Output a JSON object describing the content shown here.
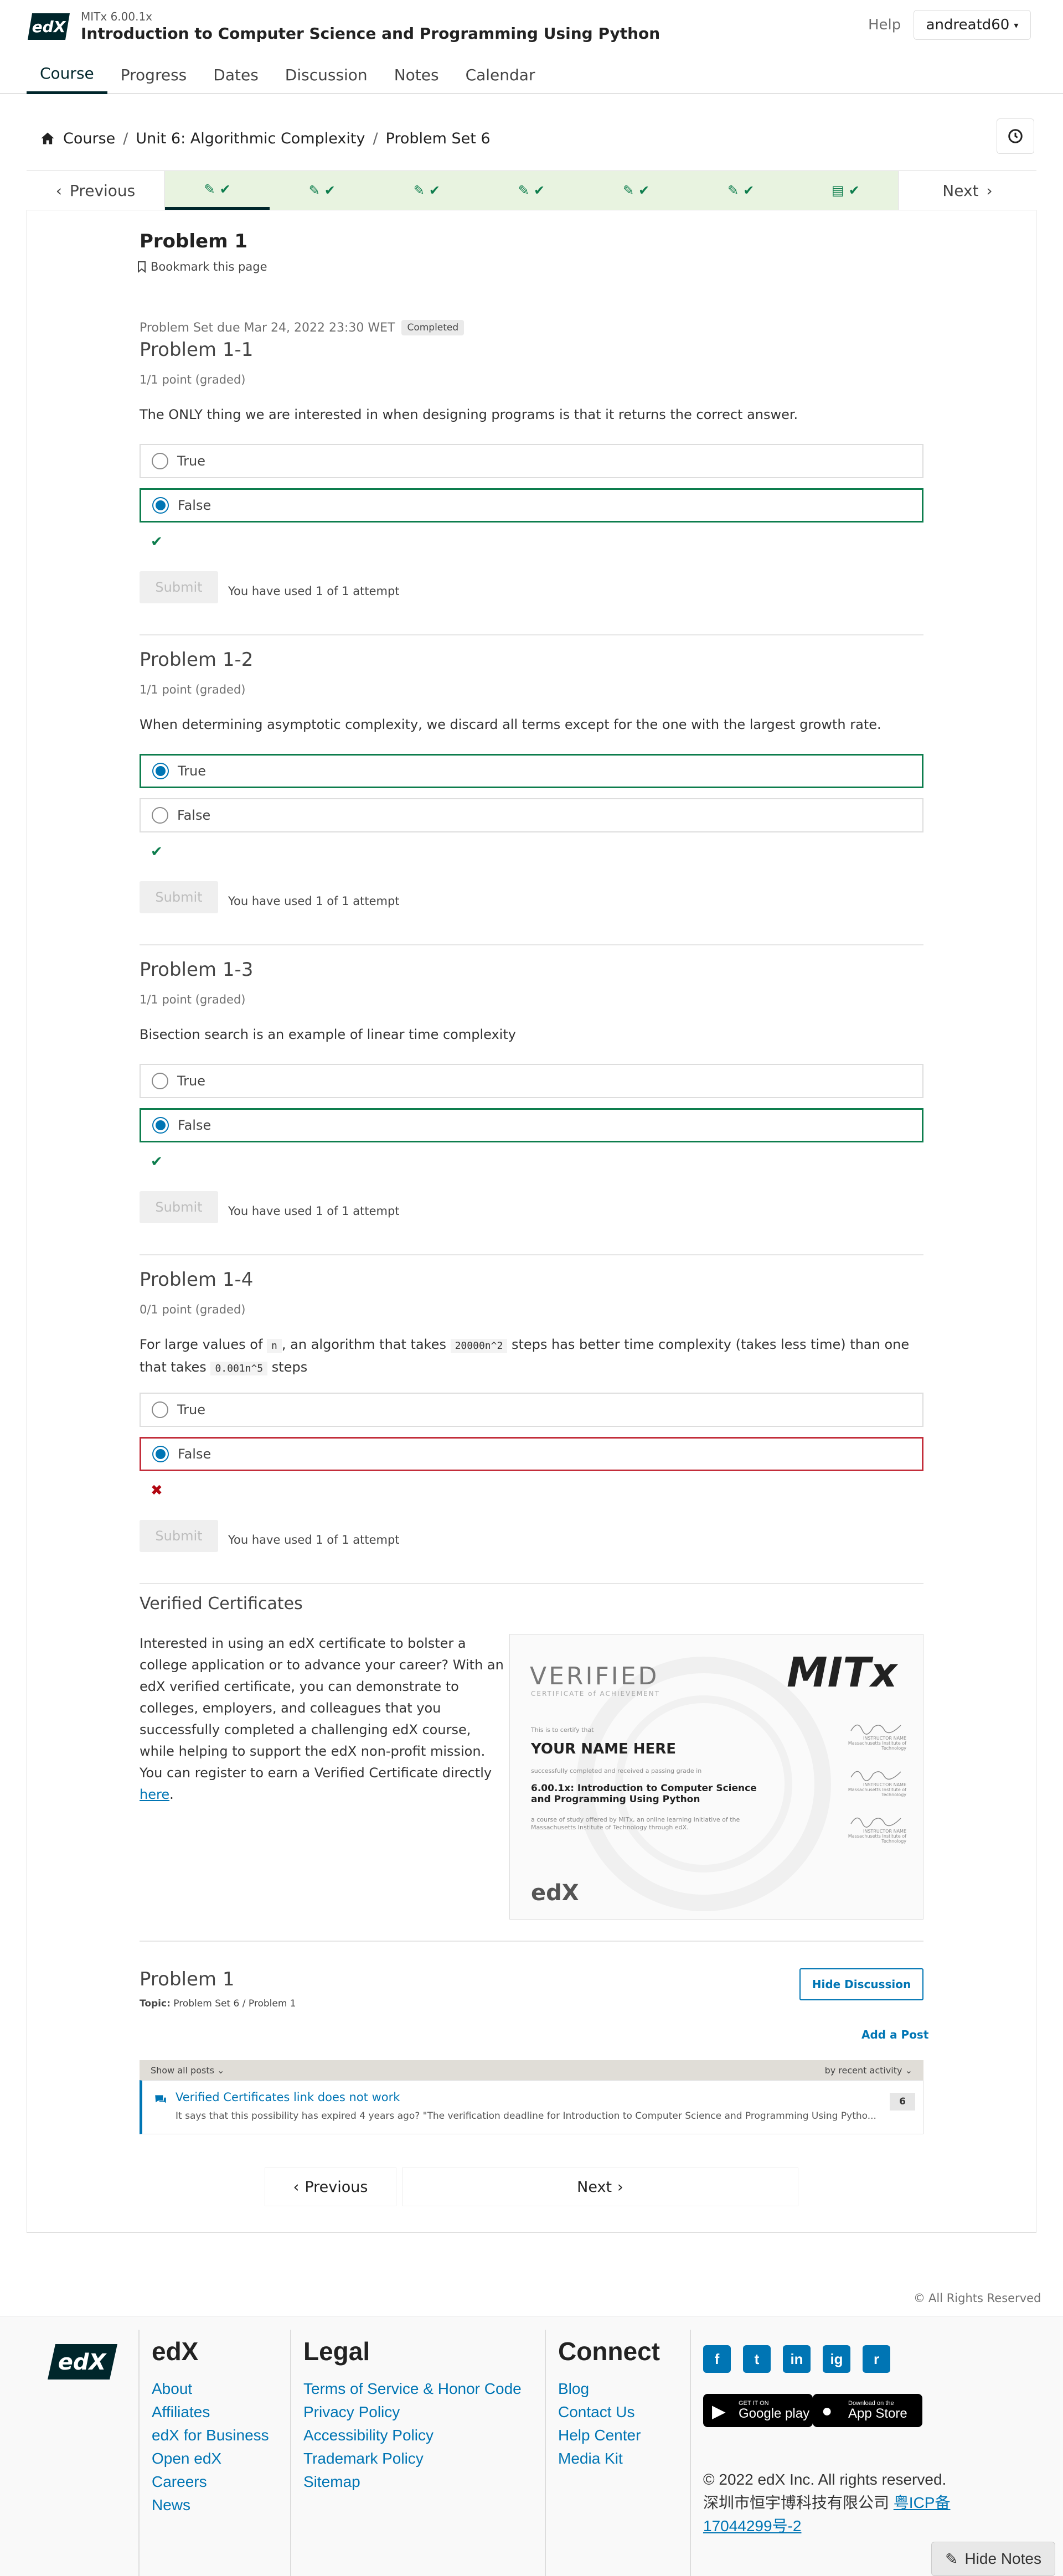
{
  "header": {
    "logo_text": "edX",
    "course_org": "MITx 6.00.1x",
    "course_title": "Introduction to Computer Science and Programming Using Python",
    "help_label": "Help",
    "username": "andreatd60",
    "tabs": [
      {
        "label": "Course",
        "active": true
      },
      {
        "label": "Progress"
      },
      {
        "label": "Dates"
      },
      {
        "label": "Discussion"
      },
      {
        "label": "Notes"
      },
      {
        "label": "Calendar"
      }
    ]
  },
  "breadcrumb": {
    "items": [
      "Course",
      "Unit 6: Algorithmic Complexity",
      "Problem Set 6"
    ]
  },
  "sequence": {
    "previous_label": "Previous",
    "next_label": "Next",
    "unit_count": 7
  },
  "unit": {
    "title": "Problem 1",
    "bookmark_label": "Bookmark this page",
    "due_text": "Problem Set due Mar 24, 2022 23:30 WET",
    "status_badge": "Completed"
  },
  "problems": [
    {
      "title": "Problem 1-1",
      "score": "1/1 point (graded)",
      "question": "The ONLY thing we are interested in when designing programs is that it returns the correct answer.",
      "choices": [
        "True",
        "False"
      ],
      "selected": 1,
      "correct": true,
      "submit_label": "Submit",
      "attempts": "You have used 1 of 1 attempt"
    },
    {
      "title": "Problem 1-2",
      "score": "1/1 point (graded)",
      "question": "When determining asymptotic complexity, we discard all terms except for the one with the largest growth rate.",
      "choices": [
        "True",
        "False"
      ],
      "selected": 0,
      "correct": true,
      "submit_label": "Submit",
      "attempts": "You have used 1 of 1 attempt"
    },
    {
      "title": "Problem 1-3",
      "score": "1/1 point (graded)",
      "question": "Bisection search is an example of linear time complexity",
      "choices": [
        "True",
        "False"
      ],
      "selected": 1,
      "correct": true,
      "submit_label": "Submit",
      "attempts": "You have used 1 of 1 attempt"
    },
    {
      "title": "Problem 1-4",
      "score": "0/1 point (graded)",
      "question_parts": {
        "p1": "For large values of",
        "c1": "n",
        "p2": ", an algorithm that takes",
        "c2": "20000n^2",
        "p3": "steps has better time complexity (takes less time) than one that takes",
        "c3": "0.001n^5",
        "p4": "steps"
      },
      "choices": [
        "True",
        "False"
      ],
      "selected": 1,
      "correct": false,
      "submit_label": "Submit",
      "attempts": "You have used 1 of 1 attempt"
    }
  ],
  "verified": {
    "heading": "Verified Certificates",
    "body": "Interested in using an edX certificate to bolster a college application or to advance your career? With an edX verified certificate, you can demonstrate to colleges, employers, and colleagues that you successfully completed a challenging edX course, while helping to support the edX non-profit mission. You can register to earn a Verified Certificate directly",
    "link_text": "here",
    "certificate": {
      "verified_word": "VERIFIED",
      "sub": "CERTIFICATE of ACHIEVEMENT",
      "brand": "MITx",
      "certify_line": "This is to certify that",
      "name": "YOUR NAME HERE",
      "completed_line": "successfully completed and received a passing grade in",
      "course": "6.00.1x: Introduction to Computer Science and Programming Using Python",
      "offered_line": "a course of study offered by MITx, an online learning initiative of the Massachusetts Institute of Technology through edX.",
      "instructor_label": "INSTRUCTOR NAME",
      "institution": "Massachusetts Institute of Technology",
      "footer_logo": "edX"
    }
  },
  "discussion": {
    "title": "Problem 1",
    "topic_label": "Topic:",
    "topic_value": "Problem Set 6 / Problem 1",
    "hide_label": "Hide Discussion",
    "add_post_label": "Add a Post",
    "filter_label": "Show all posts",
    "sort_label": "by recent activity",
    "thread_title": "Verified Certificates link does not work",
    "thread_preview": "It says that this possibility has expired 4 years ago? \"The verification deadline for Introduction to Computer Science and Programming Using Pytho...",
    "thread_count": "6"
  },
  "bottom_nav": {
    "previous_label": "Previous",
    "next_label": "Next"
  },
  "footer": {
    "rights": "All Rights Reserved",
    "logo_text": "edX",
    "columns": {
      "edx": {
        "heading": "edX",
        "links": [
          "About",
          "Affiliates",
          "edX for Business",
          "Open edX",
          "Careers",
          "News"
        ]
      },
      "legal": {
        "heading": "Legal",
        "links": [
          "Terms of Service & Honor Code",
          "Privacy Policy",
          "Accessibility Policy",
          "Trademark Policy",
          "Sitemap"
        ]
      },
      "connect": {
        "heading": "Connect",
        "links": [
          "Blog",
          "Contact Us",
          "Help Center",
          "Media Kit"
        ]
      }
    },
    "social": [
      "f",
      "t",
      "in",
      "ig",
      "r"
    ],
    "google_play": {
      "small": "GET IT ON",
      "big": "Google play"
    },
    "app_store": {
      "small": "Download on the",
      "big": "App Store"
    },
    "copyright": "© 2022 edX Inc. All rights reserved.",
    "icp_company": "深圳市恒宇博科技有限公司",
    "icp_link": "粤ICP备",
    "icp_number": "17044299号-2",
    "hide_notes_label": "Hide Notes"
  },
  "colors": {
    "brand_dark": "#00262b",
    "link": "#0075b4",
    "correct": "#0d7d4d",
    "incorrect": "#c32d3a",
    "completed_unit": "#e8f3e0"
  }
}
